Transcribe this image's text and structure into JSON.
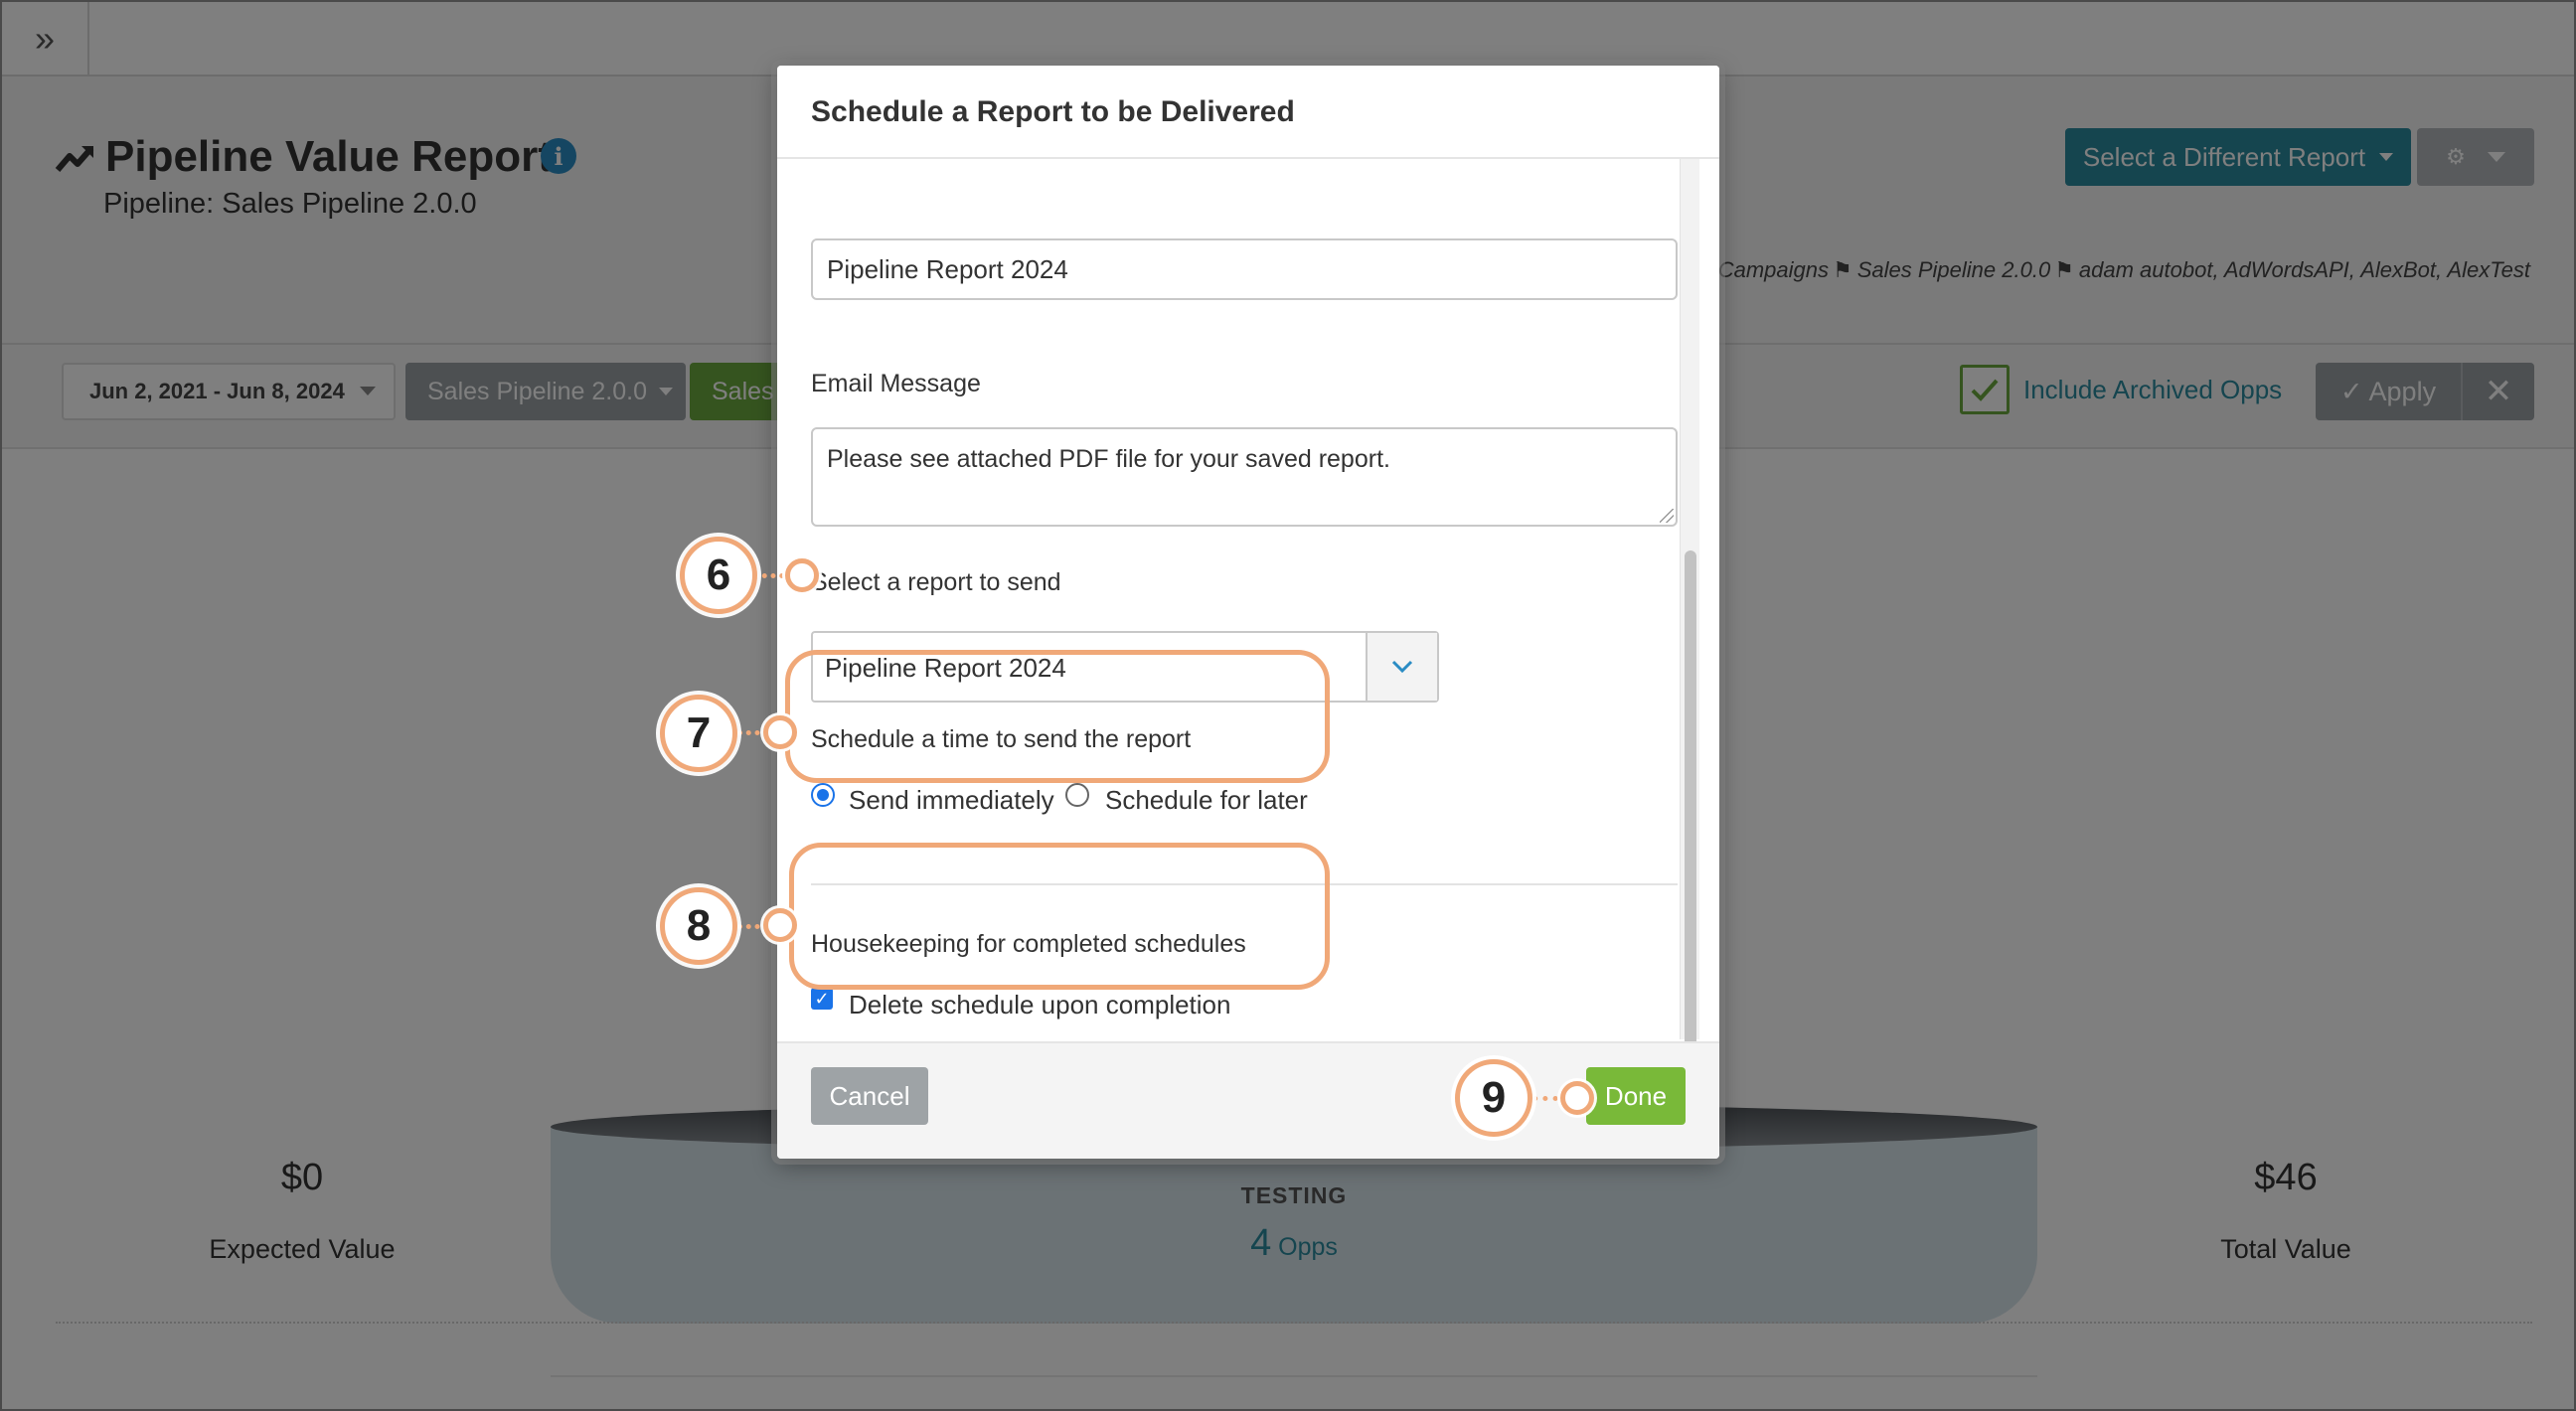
{
  "topbar": {
    "expand_icon": "»"
  },
  "header": {
    "title": "Pipeline Value Report",
    "subtitle": "Pipeline: Sales Pipeline 2.0.0",
    "select_report_label": "Select a Different Report",
    "meta_line": "ive Campaigns ⚑ Sales Pipeline 2.0.0 ⚑ adam autobot, AdWordsAPI, AlexBot, AlexTest"
  },
  "filters": {
    "date_range": "Jun 2, 2021 - Jun 8, 2024",
    "pipeline": "Sales Pipeline 2.0.0",
    "stage": "Sales R",
    "include_archived_label": "Include Archived Opps",
    "apply_label": "Apply"
  },
  "main": {
    "expected_value": "$0",
    "expected_value_label": "Expected Value",
    "total_value": "$46",
    "total_value_label": "Total Value",
    "stage_name": "TESTING",
    "stage_count": "4",
    "stage_count_unit": "Opps"
  },
  "modal": {
    "title": "Schedule a Report to be Delivered",
    "subject_value": "Pipeline Report 2024",
    "email_message_label": "Email Message",
    "email_message_value": "Please see attached PDF file for your saved report.",
    "select_report_label": "Select a report to send",
    "selected_report": "Pipeline Report 2024",
    "schedule_label": "Schedule a time to send the report",
    "send_immediately_label": "Send immediately",
    "schedule_later_label": "Schedule for later",
    "housekeeping_label": "Housekeeping for completed schedules",
    "delete_schedule_label": "Delete schedule upon completion",
    "cancel_label": "Cancel",
    "done_label": "Done"
  },
  "annotations": {
    "step6": "6",
    "step7": "7",
    "step8": "8",
    "step9": "9"
  },
  "colors": {
    "accent_teal": "#2b8a9e",
    "done_green": "#79b939",
    "callout_orange": "#f0a878",
    "radio_blue": "#1a73e8"
  },
  "state": {
    "schedule_option": "send-immediately",
    "delete_schedule_checked": true,
    "include_archived_checked": true
  }
}
